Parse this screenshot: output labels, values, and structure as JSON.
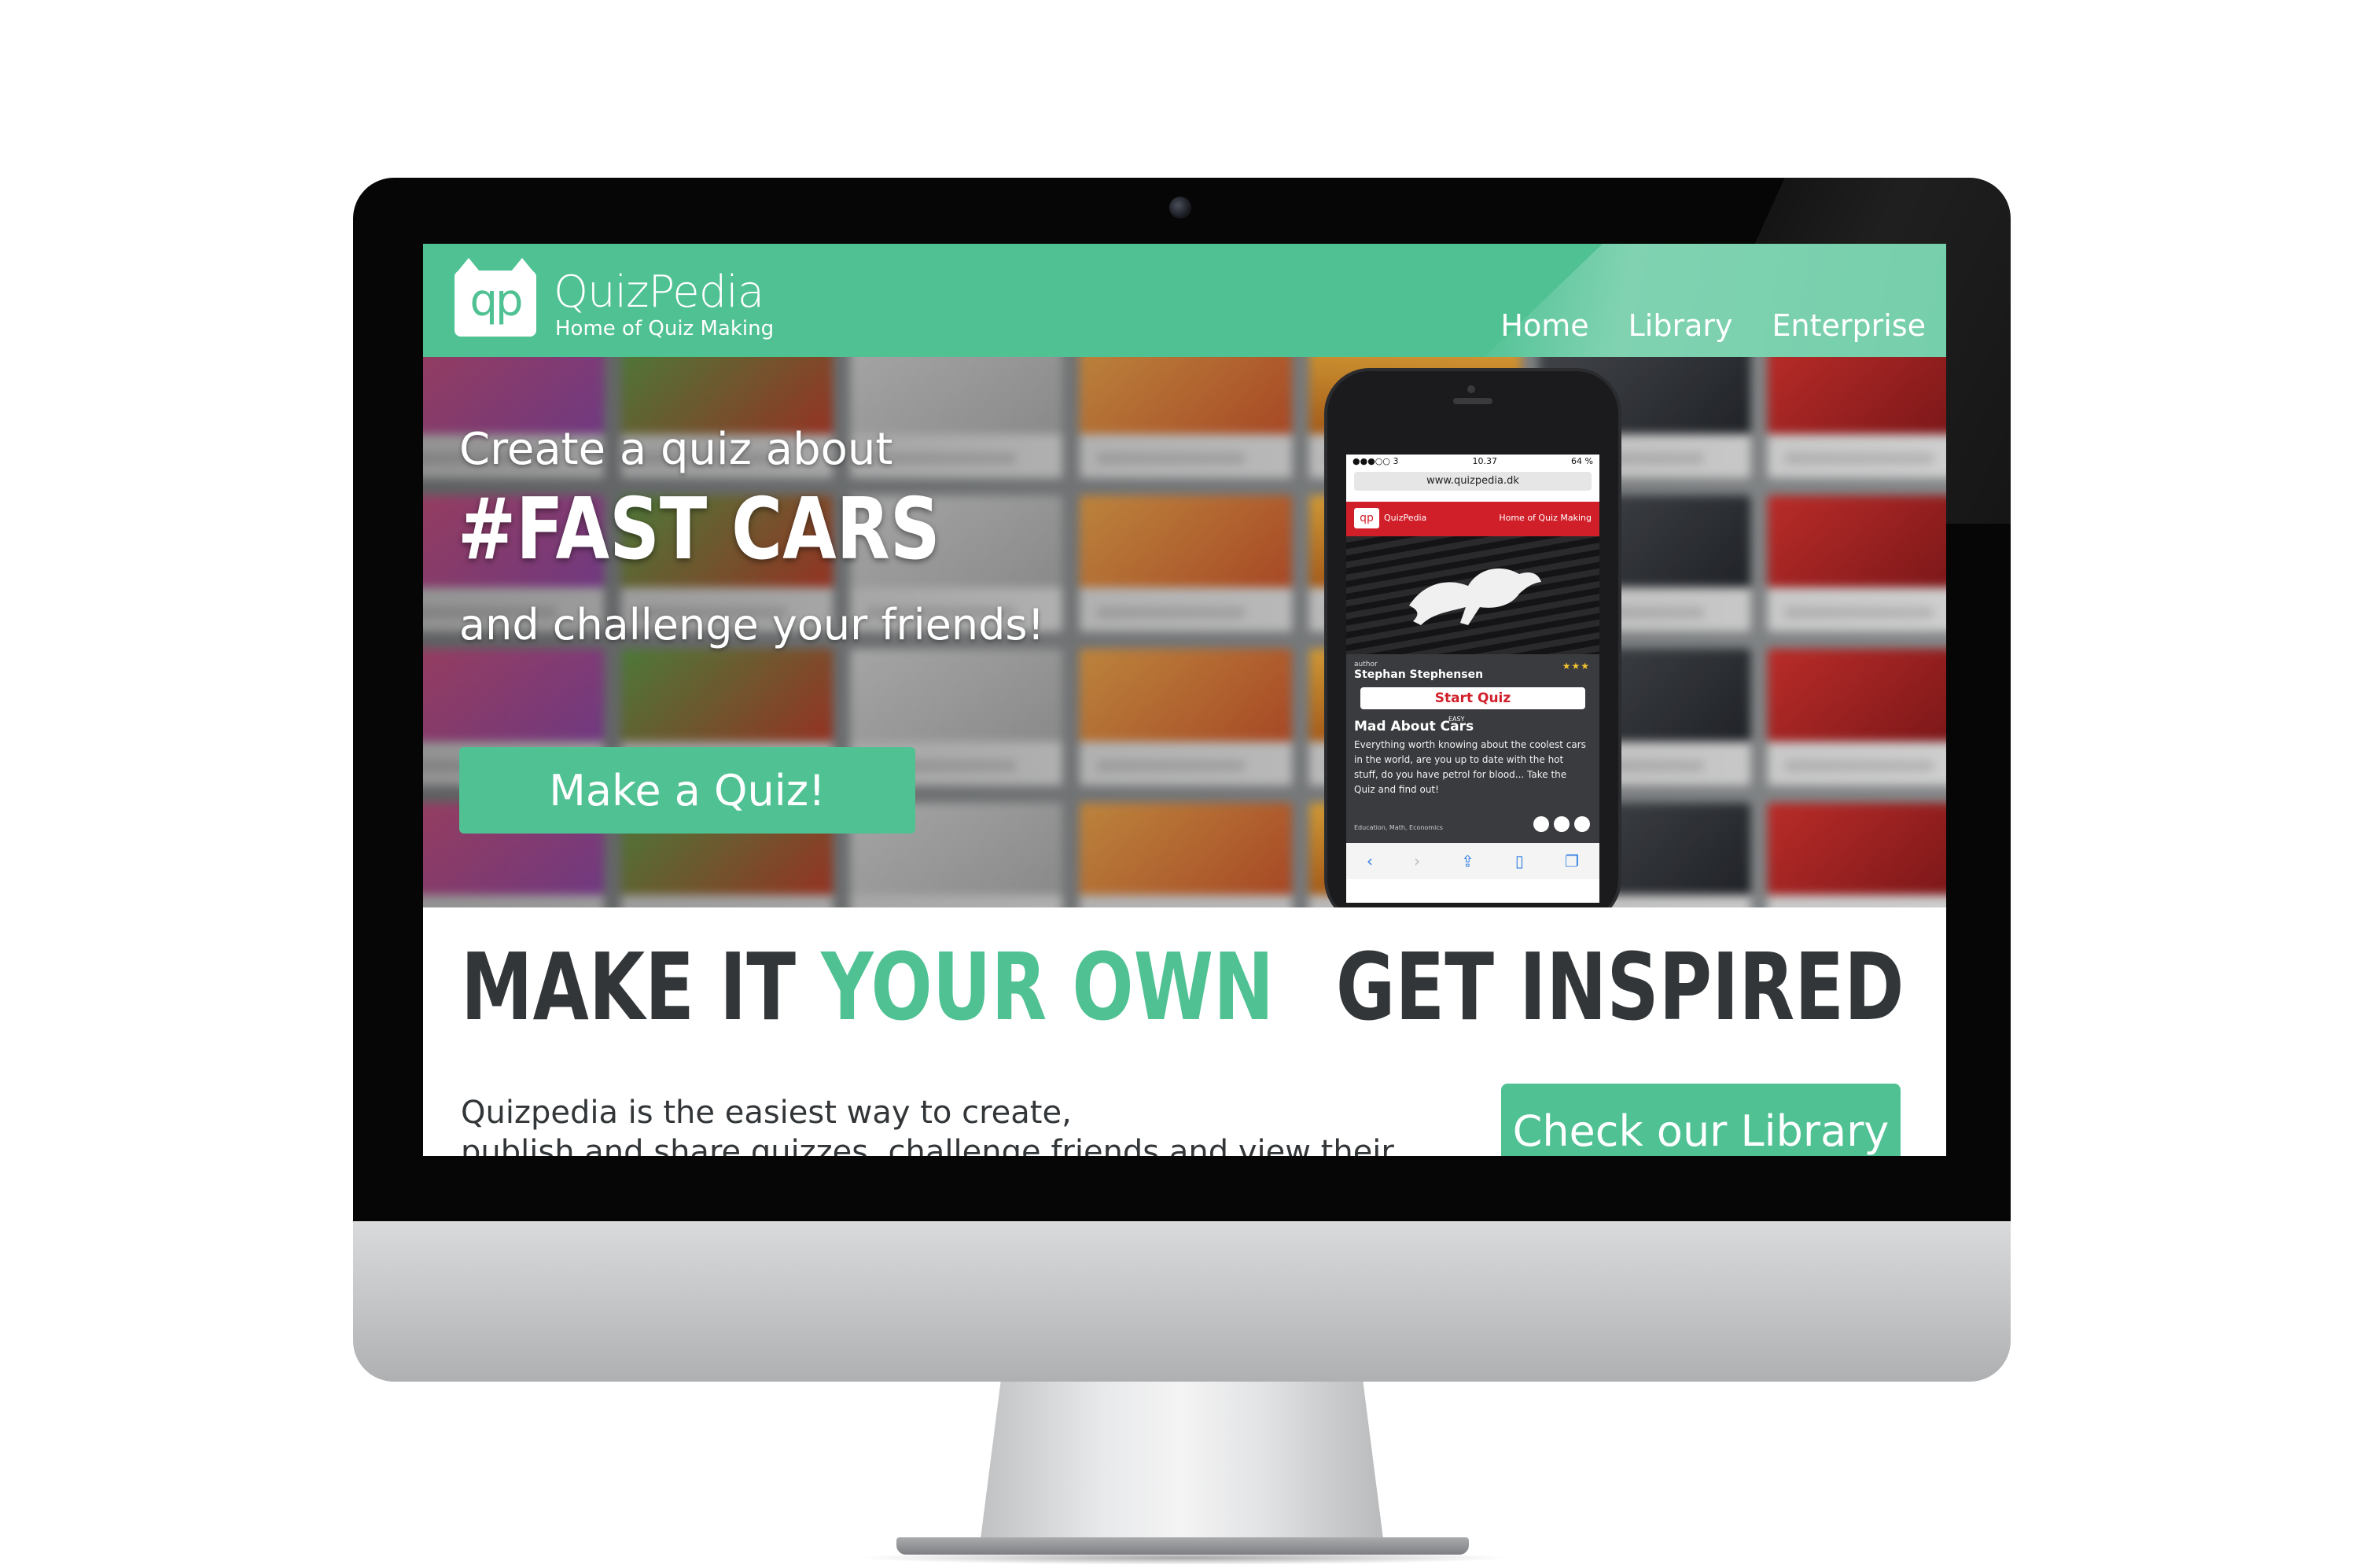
{
  "site": {
    "brand_name": "QuizPedia",
    "tagline": "Home of Quiz Making",
    "logo_letters": "qp",
    "nav": [
      {
        "label": "Home"
      },
      {
        "label": "Library"
      },
      {
        "label": "Enterprise"
      }
    ]
  },
  "hero": {
    "line1": "Create a quiz about",
    "hashtag": "#FAST CARS",
    "line3": "and challenge your friends!",
    "cta_label": "Make a Quiz!"
  },
  "phone": {
    "status_left": "●●●○○ 3",
    "status_time": "10.37",
    "status_right": "64 %",
    "url": "www.quizpedia.dk",
    "brand": "QuizPedia",
    "logo_letters": "qp",
    "tagline": "Home of Quiz Making",
    "author_label": "author",
    "author": "Stephan Stephensen",
    "stars": "★★★",
    "start_label": "Start Quiz",
    "quiz_title": "Mad About Cars",
    "difficulty": "EASY",
    "description": "Everything worth knowing about the coolest cars in the world, are you up to date with the hot stuff, do you have petrol for blood... Take the Quiz and find out!",
    "categories": "Education, Math, Economics"
  },
  "sections": {
    "left_title_a": "MAKE IT ",
    "left_title_b": "YOUR OWN",
    "right_title": "GET INSPIRED",
    "body_line1": "Quizpedia is the easiest way to create,",
    "body_line2": "publish and share quizzes, challenge friends and view their results!",
    "library_cta": "Check our Library"
  },
  "colors": {
    "brand_green": "#4fc193",
    "heading_dark": "#333638",
    "phone_red": "#d11f2a"
  }
}
